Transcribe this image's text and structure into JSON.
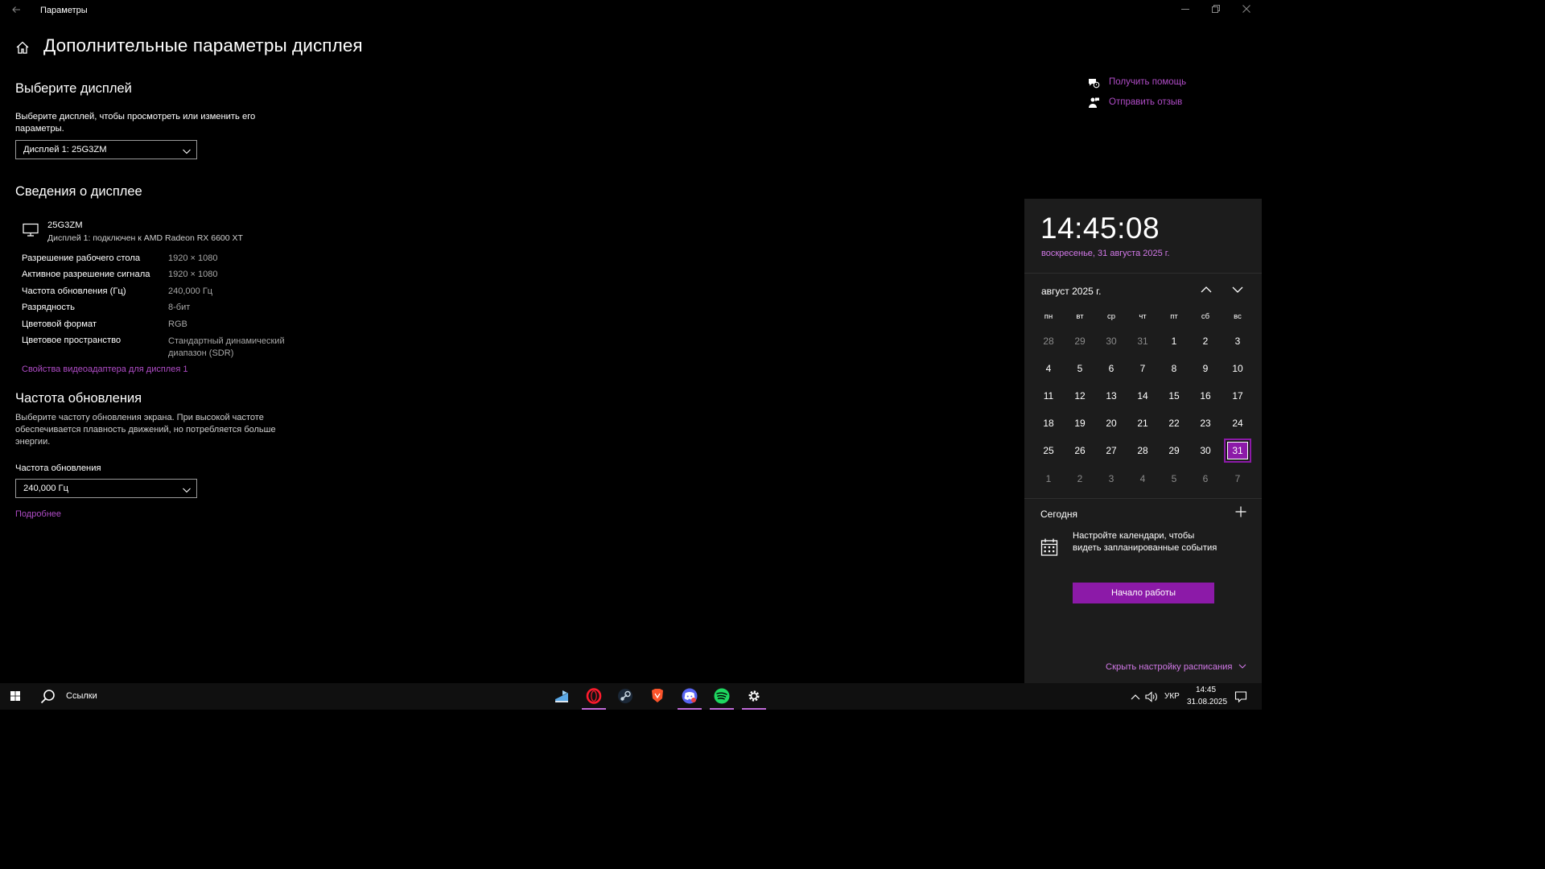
{
  "window": {
    "title": "Параметры",
    "back_icon": "back-arrow-icon",
    "minimize": "–",
    "restore": "❐",
    "close": "✕"
  },
  "page": {
    "title": "Дополнительные параметры дисплея",
    "home_icon": "home-icon"
  },
  "select_display": {
    "heading": "Выберите дисплей",
    "description": "Выберите дисплей, чтобы просмотреть или изменить его параметры.",
    "selected": "Дисплей 1: 25G3ZM"
  },
  "display_info": {
    "heading": "Сведения о дисплее",
    "monitor_name": "25G3ZM",
    "monitor_sub": "Дисплей 1: подключен к AMD Radeon RX 6600 XT",
    "rows": [
      {
        "label": "Разрешение рабочего стола",
        "value": "1920 × 1080"
      },
      {
        "label": "Активное разрешение сигнала",
        "value": "1920 × 1080"
      },
      {
        "label": "Частота обновления (Гц)",
        "value": "240,000 Гц"
      },
      {
        "label": "Разрядность",
        "value": "8-бит"
      },
      {
        "label": "Цветовой формат",
        "value": "RGB"
      },
      {
        "label": "Цветовое пространство",
        "value": "Стандартный динамический диапазон (SDR)"
      }
    ],
    "adapter_link": "Свойства видеоадаптера для дисплея 1"
  },
  "refresh": {
    "heading": "Частота обновления",
    "description": "Выберите частоту обновления экрана. При высокой частоте обеспечивается плавность движений, но потребляется больше энергии.",
    "label": "Частота обновления",
    "selected": "240,000 Гц",
    "more_link": "Подробнее"
  },
  "help": {
    "get_help": "Получить помощь",
    "feedback": "Отправить отзыв"
  },
  "flyout": {
    "time": "14:45:08",
    "date": "воскресенье, 31 августа 2025 г.",
    "month": "август 2025 г.",
    "weekdays": [
      "пн",
      "вт",
      "ср",
      "чт",
      "пт",
      "сб",
      "вс"
    ],
    "weeks": [
      [
        "28",
        "29",
        "30",
        "31",
        "1",
        "2",
        "3"
      ],
      [
        "4",
        "5",
        "6",
        "7",
        "8",
        "9",
        "10"
      ],
      [
        "11",
        "12",
        "13",
        "14",
        "15",
        "16",
        "17"
      ],
      [
        "18",
        "19",
        "20",
        "21",
        "22",
        "23",
        "24"
      ],
      [
        "25",
        "26",
        "27",
        "28",
        "29",
        "30",
        "31"
      ],
      [
        "1",
        "2",
        "3",
        "4",
        "5",
        "6",
        "7"
      ]
    ],
    "today_label": "Сегодня",
    "setup_text": "Настройте календари, чтобы видеть запланированные события",
    "start_button": "Начало работы",
    "hide_link": "Скрыть настройку расписания"
  },
  "taskbar": {
    "search_text": "Ссылки",
    "lang": "УКР",
    "time": "14:45",
    "date": "31.08.2025",
    "accent": "#c06ad8"
  },
  "colors": {
    "accent": "#8c1aa8",
    "link": "#b04cc7"
  }
}
